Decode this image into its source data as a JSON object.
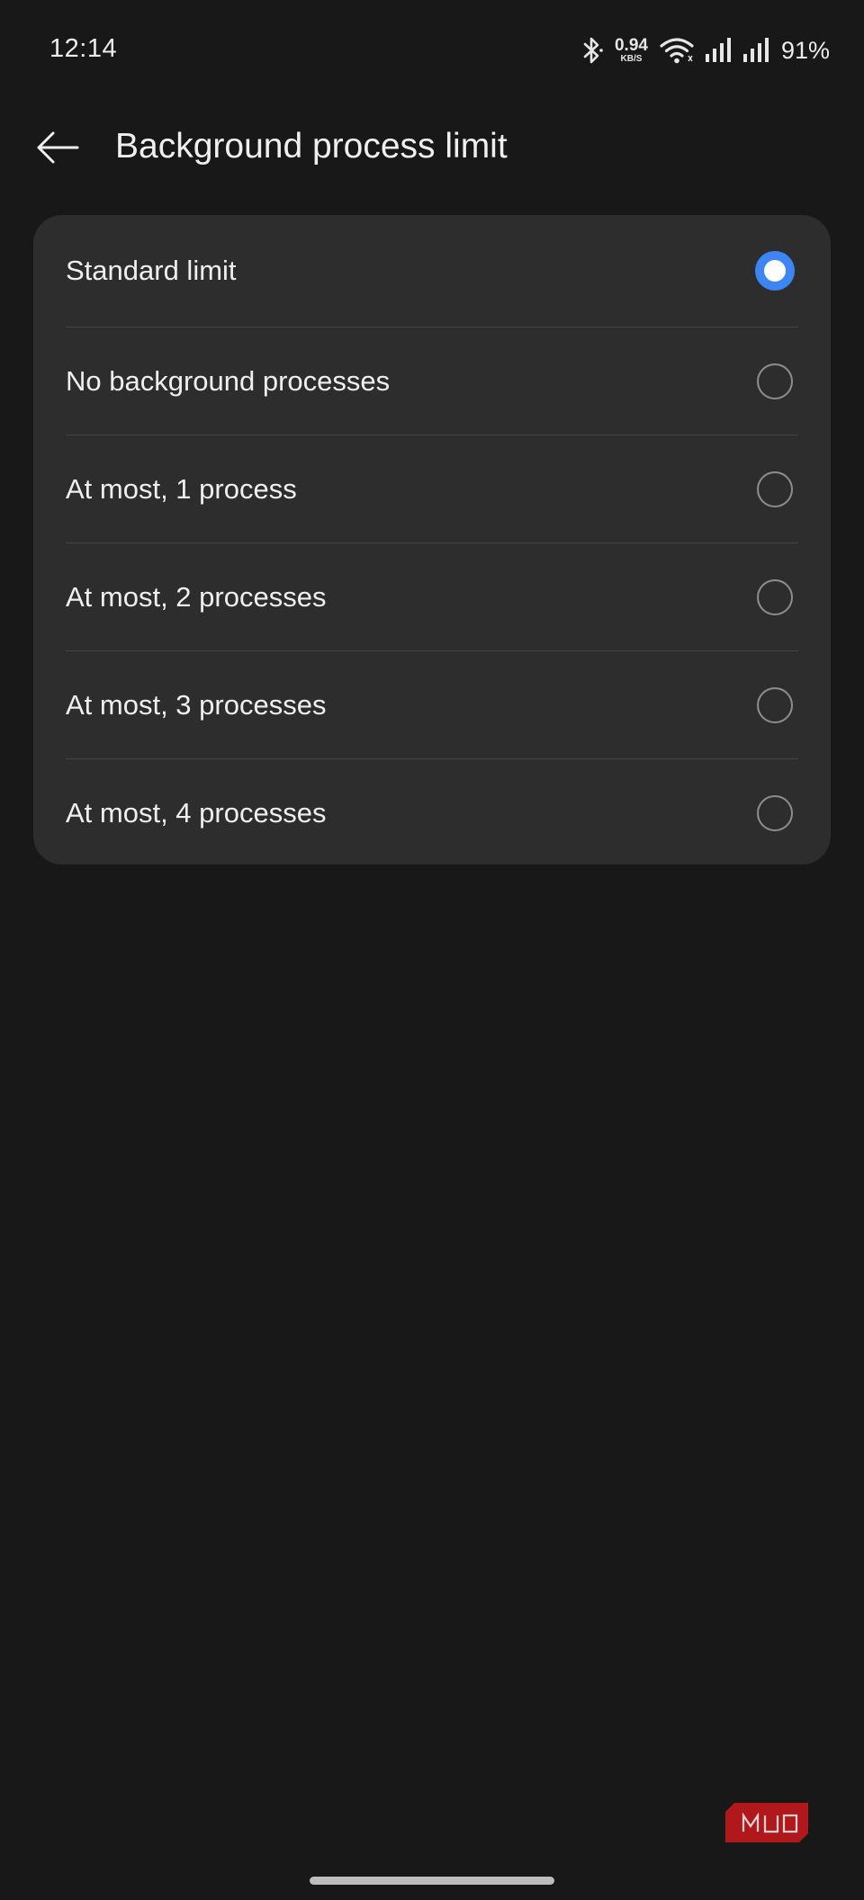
{
  "status_bar": {
    "time": "12:14",
    "net_speed_value": "0.94",
    "net_speed_unit": "KB/S",
    "battery_percent": "91%",
    "icons": [
      "bluetooth-icon",
      "wifi-icon",
      "signal-icon",
      "signal-icon"
    ]
  },
  "header": {
    "back_icon": "arrow-left-icon",
    "title": "Background process limit"
  },
  "options": {
    "selected_index": 0,
    "accent_color": "#3e85f4",
    "items": [
      {
        "label": "Standard limit",
        "selected": true
      },
      {
        "label": "No background processes",
        "selected": false
      },
      {
        "label": "At most, 1 process",
        "selected": false
      },
      {
        "label": "At most, 2 processes",
        "selected": false
      },
      {
        "label": "At most, 3 processes",
        "selected": false
      },
      {
        "label": "At most, 4 processes",
        "selected": false
      }
    ]
  },
  "watermark": {
    "text": "MUO",
    "color": "#b0181b"
  },
  "colors": {
    "background": "#181818",
    "card": "#2d2d2d",
    "divider": "#454545",
    "text": "#efefef"
  }
}
